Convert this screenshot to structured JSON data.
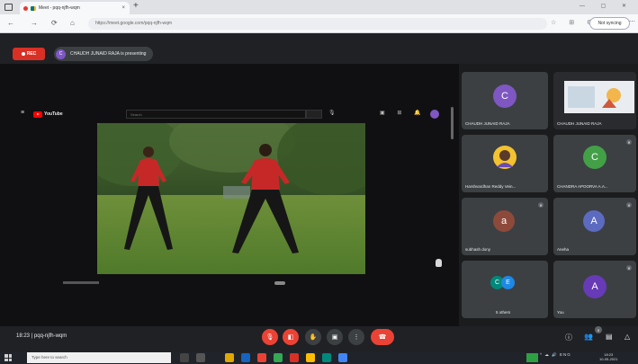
{
  "browser": {
    "tab_title": "Meet - pqq-njfh-wqm",
    "tab_close": "×",
    "new_tab": "+",
    "window_controls": "— ▢ ✕",
    "nav_back": "←",
    "nav_forward": "→",
    "nav_refresh": "⟳",
    "nav_home": "⌂",
    "url": "https://meet.google.com/pqq-njfh-wqm",
    "toolbar_icons": "☆ ⊞ ⚙",
    "profile_label": "Not syncing",
    "more": "⋯"
  },
  "meet_top": {
    "rec_label": "REC",
    "presenter_initial": "C",
    "presenting_text": "CHAUDH JUNAID RAJA is presenting"
  },
  "youtube": {
    "menu": "≡",
    "logo_text": "YouTube",
    "search_placeholder": "Search",
    "mic": "🎙",
    "right_icons": "▣ ⊞ 🔔"
  },
  "tiles": [
    {
      "initial": "C",
      "name": "CHAUDH JUNAID RAJA",
      "avatar_color": "#7e57c2"
    },
    {
      "initial": "",
      "name": "CHAUDH JUNAID RAJA",
      "avatar_color": ""
    },
    {
      "initial": "",
      "name": "Harshvardhan Reddy Vein...",
      "avatar_color": "#f2c230"
    },
    {
      "initial": "C",
      "name": "CHANDRA APOORVA A.A...",
      "avatar_color": "#43a047"
    },
    {
      "initial": "a",
      "name": "subhash dony",
      "avatar_color": "#8d4a3b"
    },
    {
      "initial": "A",
      "name": "Aneha",
      "avatar_color": "#5c6bc0"
    },
    {
      "initial": "",
      "name": "5 others",
      "avatar_color": ""
    },
    {
      "initial": "A",
      "name": "You",
      "avatar_color": "#673ab7"
    }
  ],
  "others_initials": [
    "C",
    "E"
  ],
  "bottom": {
    "meeting_info": "18:23  |  pqq-njfh-wqm",
    "mic_icon": "🎙",
    "cam_icon": "◧",
    "hand_icon": "✋",
    "present_icon": "▣",
    "more_icon": "⋮",
    "end_icon": "☎",
    "info_icon": "ⓘ",
    "people_icon": "👥",
    "people_count": "9",
    "chat_icon": "▤",
    "activities_icon": "△"
  },
  "taskbar": {
    "search_placeholder": "Type here to search",
    "tray_text": "^ ☁ 🔊 ENG",
    "time": "18:23",
    "date": "10-05-2021"
  },
  "colors": {
    "accent_red": "#ea4335",
    "tile_bg": "#3c4043",
    "meet_bg": "#202124"
  }
}
